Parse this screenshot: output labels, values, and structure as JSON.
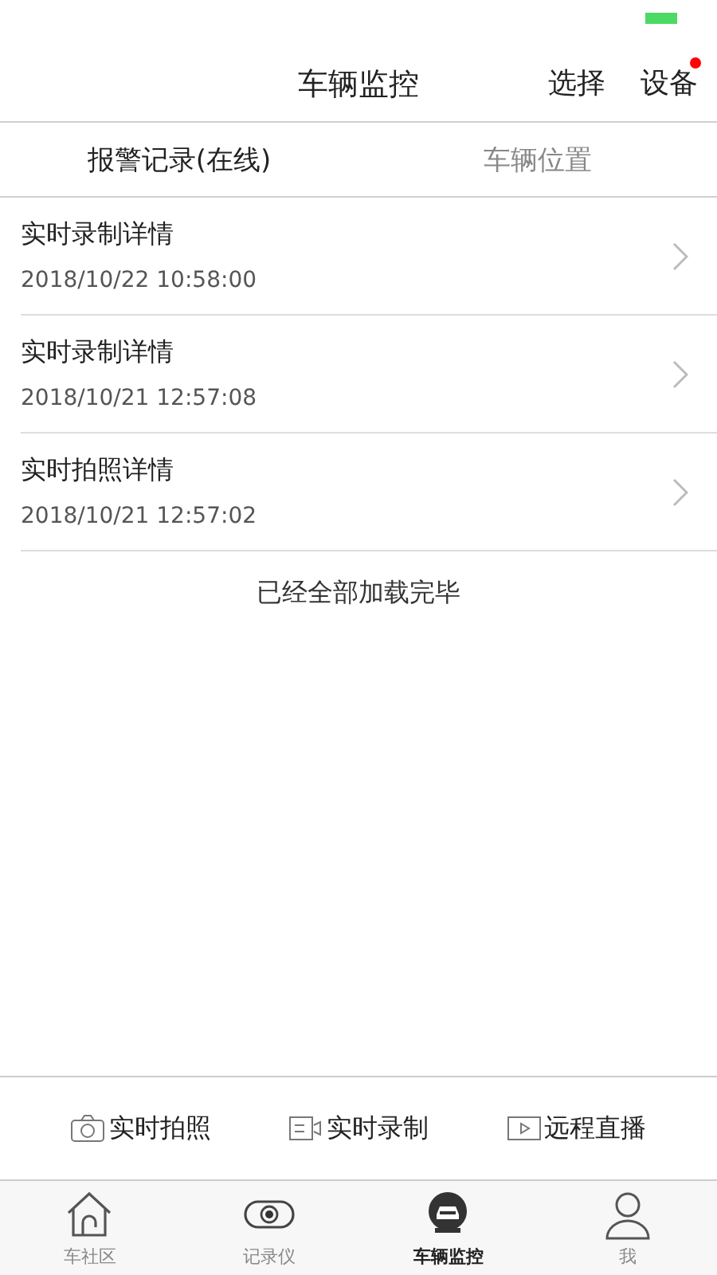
{
  "header": {
    "title": "车辆监控",
    "actions": [
      {
        "label": "选择",
        "badge": false
      },
      {
        "label": "设备",
        "badge": true
      }
    ]
  },
  "tabs": [
    {
      "label": "报警记录(在线)",
      "selected": true
    },
    {
      "label": "车辆位置",
      "selected": false
    }
  ],
  "records": [
    {
      "title": "实时录制详情",
      "time": "2018/10/22 10:58:00"
    },
    {
      "title": "实时录制详情",
      "time": "2018/10/21 12:57:08"
    },
    {
      "title": "实时拍照详情",
      "time": "2018/10/21 12:57:02"
    }
  ],
  "list_footer": "已经全部加载完毕",
  "actions": [
    {
      "kind": "photo",
      "label": "实时拍照"
    },
    {
      "kind": "record",
      "label": "实时录制"
    },
    {
      "kind": "live",
      "label": "远程直播"
    }
  ],
  "nav": [
    {
      "kind": "home",
      "label": "车社区",
      "selected": false
    },
    {
      "kind": "recorder",
      "label": "记录仪",
      "selected": false
    },
    {
      "kind": "car",
      "label": "车辆监控",
      "selected": true
    },
    {
      "kind": "user",
      "label": "我",
      "selected": false
    }
  ]
}
